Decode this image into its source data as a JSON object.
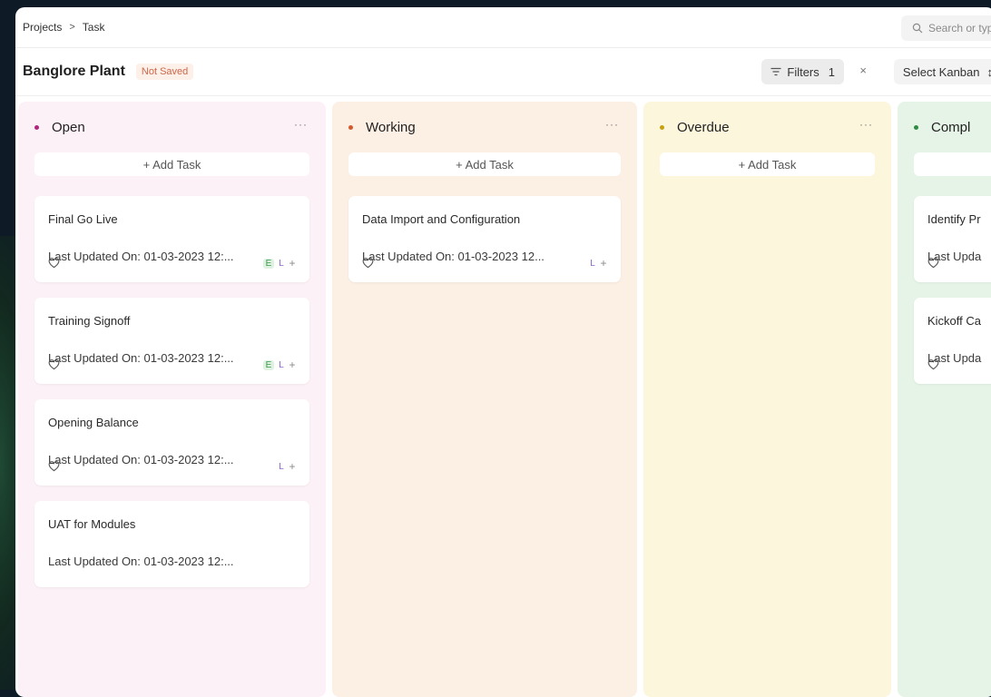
{
  "breadcrumb": {
    "items": [
      "Projects",
      "Task"
    ],
    "separator": ">"
  },
  "search": {
    "placeholder": "Search or typ"
  },
  "header": {
    "title": "Banglore Plant",
    "status_badge": "Not Saved",
    "filters_label": "Filters",
    "filters_count": "1",
    "filters_clear": "×",
    "select_kanban_label": "Select Kanban",
    "select_kanban_chevron": "↕"
  },
  "icons": {
    "search": "search-icon",
    "filter": "filter-icon",
    "heart": "heart-icon",
    "more": "more-icon"
  },
  "colors": {
    "open_bg": "#fdf1f8",
    "open_dot": "#b0267a",
    "working_bg": "#fcefe4",
    "working_dot": "#d25a2c",
    "overdue_bg": "#fcf7dc",
    "overdue_dot": "#c9a00e",
    "complete_bg": "#e6f3e7",
    "complete_dot": "#2f8a42"
  },
  "columns": [
    {
      "title": "Open",
      "more": "···",
      "add_task": "+ Add Task",
      "cards": [
        {
          "title": "Final Go Live",
          "updated": "Last Updated On: 01-03-2023 12:...",
          "assignees": [
            "E",
            "L"
          ],
          "add": "+"
        },
        {
          "title": "Training Signoff",
          "updated": "Last Updated On: 01-03-2023 12:...",
          "assignees": [
            "E",
            "L"
          ],
          "add": "+"
        },
        {
          "title": "Opening Balance",
          "updated": "Last Updated On: 01-03-2023 12:...",
          "assignees": [
            "L"
          ],
          "add": "+"
        },
        {
          "title": "UAT for Modules",
          "updated": "Last Updated On: 01-03-2023 12:..."
        }
      ]
    },
    {
      "title": "Working",
      "more": "···",
      "add_task": "+ Add Task",
      "cards": [
        {
          "title": "Data Import and Configuration",
          "updated": "Last Updated On: 01-03-2023 12...",
          "assignees": [
            "L"
          ],
          "add": "+"
        }
      ]
    },
    {
      "title": "Overdue",
      "more": "···",
      "add_task": "+ Add Task",
      "cards": []
    },
    {
      "title": "Compl",
      "cards": [
        {
          "title": "Identify Pr",
          "updated": "Last Upda"
        },
        {
          "title": "Kickoff Ca",
          "updated": "Last Upda"
        }
      ]
    }
  ]
}
